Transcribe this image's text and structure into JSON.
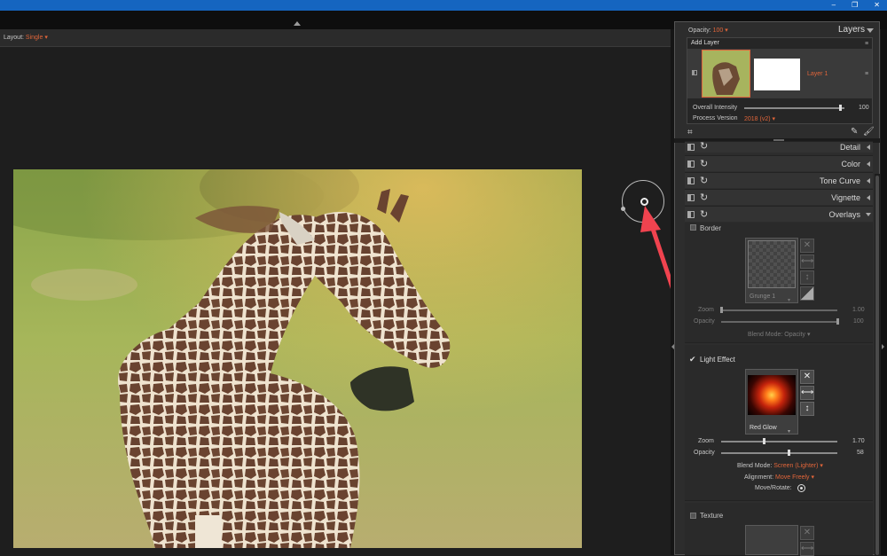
{
  "window": {
    "buttons": [
      "–",
      "❐",
      "✕"
    ]
  },
  "layout_bar": {
    "label": "Layout:",
    "value": "Single"
  },
  "layers_panel": {
    "opacity_label": "Opacity:",
    "opacity_value": "100",
    "title": "Layers",
    "add_layer": "Add Layer",
    "layer_name": "Layer 1",
    "overall_intensity_label": "Overall Intensity",
    "overall_intensity_value": "100",
    "overall_intensity_level": 0.96,
    "process_version_label": "Process Version",
    "process_version_value": "2018 (v2)"
  },
  "sections": [
    "Detail",
    "Color",
    "Tone Curve",
    "Vignette",
    "Overlays"
  ],
  "border": {
    "label": "Border",
    "preset": "Grunge 1",
    "zoom_label": "Zoom",
    "zoom_value": "1.00",
    "zoom_level": 0.0,
    "opacity_label": "Opacity",
    "opacity_value": "100",
    "opacity_level": 1.0,
    "blend_label": "Blend Mode:",
    "blend_value": "Opacity"
  },
  "light_effect": {
    "label": "Light Effect",
    "checked": true,
    "preset": "Red Glow",
    "zoom_label": "Zoom",
    "zoom_value": "1.70",
    "zoom_level": 0.37,
    "opacity_label": "Opacity",
    "opacity_value": "58",
    "opacity_level": 0.58,
    "blend_label": "Blend Mode:",
    "blend_value": "Screen (Lighter)",
    "align_label": "Alignment:",
    "align_value": "Move Freely",
    "move_label": "Move/Rotate:"
  },
  "texture": {
    "label": "Texture"
  },
  "colors": {
    "accent": "#e0653a",
    "titlebar": "#1565c0",
    "arrow": "#f0434f"
  },
  "icons": [
    "shuffle-icon",
    "flip-horizontal-icon",
    "flip-vertical-icon",
    "crop-icon",
    "pencil-icon",
    "brush-icon",
    "sync-icon",
    "target-icon"
  ]
}
